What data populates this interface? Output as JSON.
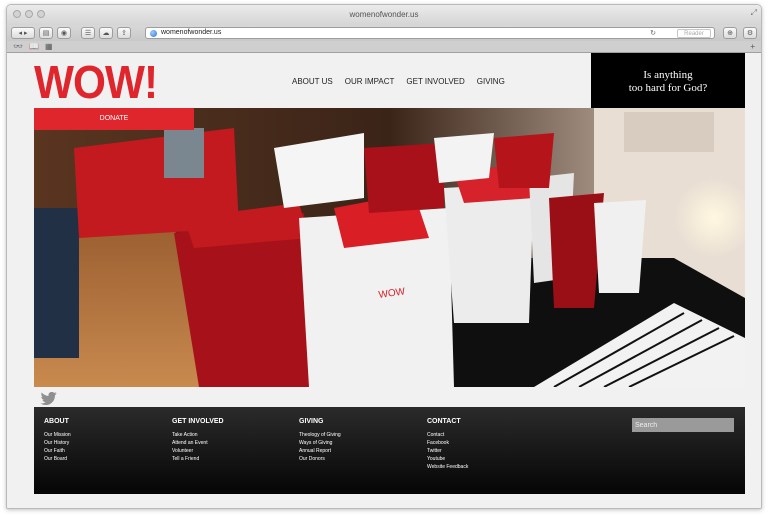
{
  "browser": {
    "window_title": "womenofwonder.us",
    "url": "womenofwonder.us",
    "reader_label": "Reader"
  },
  "site": {
    "logo": "WOW!",
    "nav": [
      "ABOUT US",
      "OUR IMPACT",
      "GET INVOLVED",
      "GIVING"
    ],
    "slogan_line1": "Is anything",
    "slogan_line2": "too hard for God?",
    "donate": "DONATE",
    "hero_bag_print": "WOW",
    "accent_color": "#e0262d"
  },
  "footer": {
    "columns": [
      {
        "heading": "ABOUT",
        "links": [
          "Our Mission",
          "Our History",
          "Our Faith",
          "Our Board"
        ]
      },
      {
        "heading": "GET INVOLVED",
        "links": [
          "Take Action",
          "Attend an Event",
          "Volunteer",
          "Tell a Friend"
        ]
      },
      {
        "heading": "GIVING",
        "links": [
          "Theology of Giving",
          "Ways of Giving",
          "Annual Report",
          "Our Donors"
        ]
      },
      {
        "heading": "CONTACT",
        "links": [
          "Contact",
          "Facebook",
          "Twitter",
          "Youtube",
          "Website Feedback"
        ]
      }
    ],
    "search_placeholder": "Search"
  }
}
